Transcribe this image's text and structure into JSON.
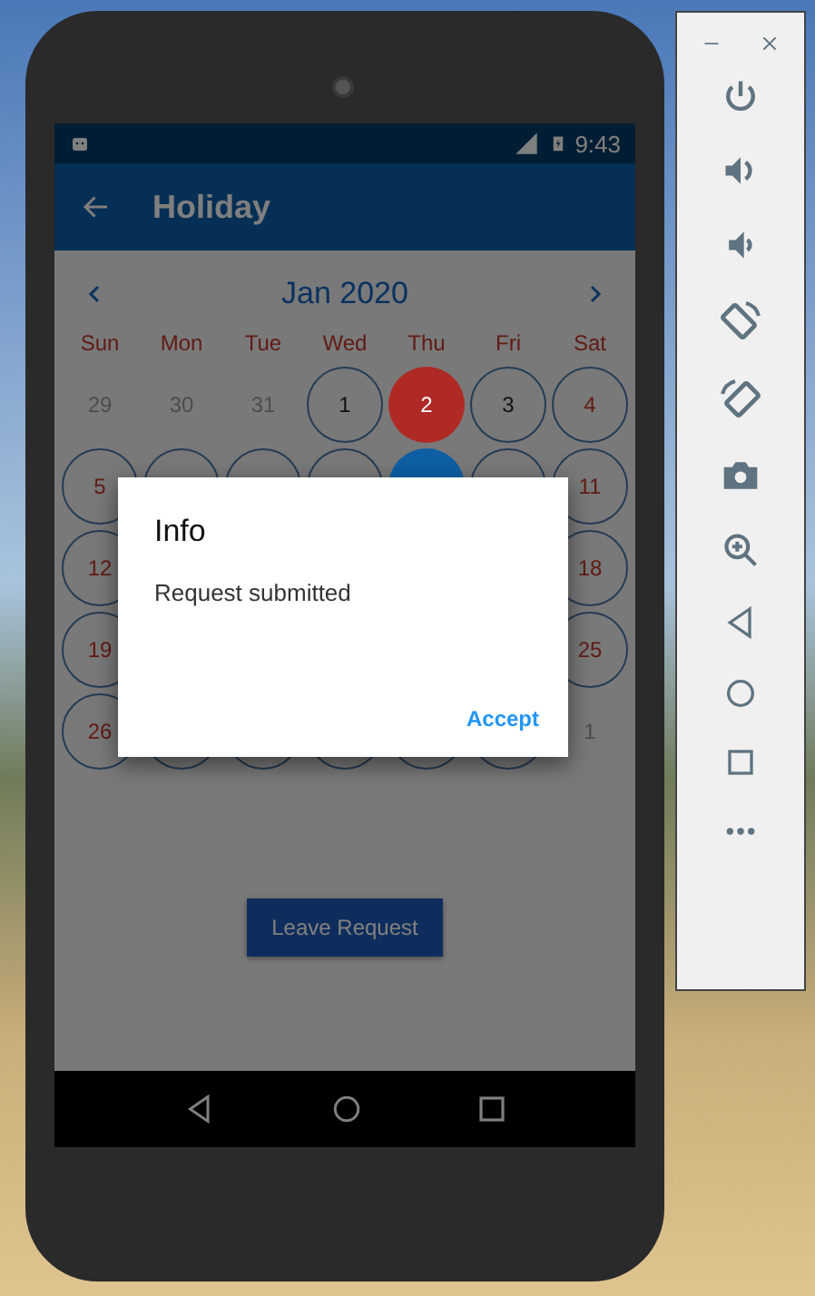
{
  "status_bar": {
    "time": "9:43"
  },
  "app_bar": {
    "title": "Holiday"
  },
  "calendar": {
    "month": "Jan 2020",
    "weekdays": [
      "Sun",
      "Mon",
      "Tue",
      "Wed",
      "Thu",
      "Fri",
      "Sat"
    ],
    "weeks": [
      [
        {
          "kind": "day",
          "day": "29",
          "in_month": false
        },
        {
          "kind": "day",
          "day": "30",
          "in_month": false
        },
        {
          "kind": "day",
          "day": "31",
          "in_month": false
        },
        {
          "kind": "day",
          "day": "1",
          "in_month": true
        },
        {
          "kind": "day",
          "day": "2",
          "in_month": true,
          "color": "#b02a25"
        },
        {
          "kind": "day",
          "day": "3",
          "in_month": true
        },
        {
          "kind": "day",
          "day": "4",
          "in_month": true
        }
      ],
      [
        {
          "kind": "day",
          "day": "5",
          "in_month": true
        },
        {
          "kind": "day",
          "in_month": true
        },
        {
          "kind": "day",
          "in_month": true
        },
        {
          "kind": "day",
          "in_month": true
        },
        {
          "kind": "day",
          "color": "#0e5fa3"
        },
        {
          "kind": "day",
          "in_month": true
        },
        {
          "kind": "day",
          "day": "11",
          "in_month": true
        }
      ],
      [
        {
          "kind": "day",
          "day": "12",
          "in_month": true
        },
        {
          "kind": "covered"
        },
        {
          "kind": "covered"
        },
        {
          "kind": "covered"
        },
        {
          "kind": "covered"
        },
        {
          "kind": "covered"
        },
        {
          "kind": "day",
          "day": "18",
          "in_month": true
        }
      ],
      [
        {
          "kind": "day",
          "day": "19",
          "in_month": true
        },
        {
          "kind": "covered"
        },
        {
          "kind": "covered"
        },
        {
          "kind": "covered"
        },
        {
          "kind": "covered"
        },
        {
          "kind": "covered"
        },
        {
          "kind": "day",
          "day": "25",
          "in_month": true
        }
      ],
      [
        {
          "kind": "day",
          "day": "26",
          "in_month": true
        },
        {
          "kind": "day",
          "in_month": true
        },
        {
          "kind": "day",
          "in_month": true
        },
        {
          "kind": "day",
          "in_month": true
        },
        {
          "kind": "day",
          "in_month": true
        },
        {
          "kind": "day",
          "in_month": true
        },
        {
          "kind": "day",
          "day": "1",
          "in_month": false
        }
      ]
    ]
  },
  "button": "Leave Request",
  "dialog": {
    "title": "Info",
    "message": "Request submitted",
    "action": "Accept"
  }
}
